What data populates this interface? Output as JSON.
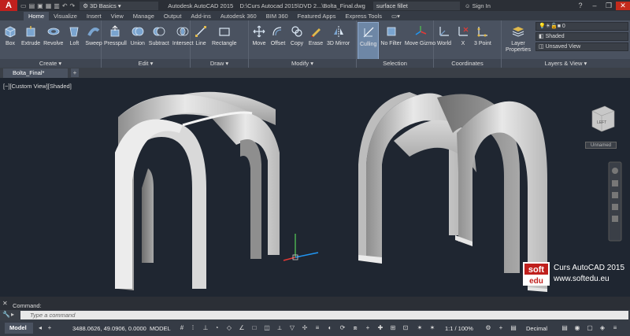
{
  "app": {
    "logo": "A",
    "workspace": "3D Basics",
    "product": "Autodesk AutoCAD 2015",
    "file_path": "D:\\Curs Autocad 2015\\DVD 2...\\Bolta_Final.dwg",
    "search_text": "surface fillet",
    "sign_in": "Sign In"
  },
  "tabs": [
    "Home",
    "Visualize",
    "Insert",
    "View",
    "Manage",
    "Output",
    "Add-ins",
    "Autodesk 360",
    "BIM 360",
    "Featured Apps",
    "Express Tools"
  ],
  "ribbon": {
    "create": {
      "title": "Create",
      "tools": [
        "Box",
        "Extrude",
        "Revolve",
        "Loft",
        "Sweep"
      ]
    },
    "edit": {
      "title": "Edit",
      "tools": [
        "Presspull",
        "Union",
        "Subtract",
        "Intersect"
      ]
    },
    "draw": {
      "title": "Draw",
      "tools": [
        "Line",
        "Rectangle"
      ]
    },
    "modify": {
      "title": "Modify",
      "tools": [
        "Move",
        "Offset",
        "Copy",
        "Erase",
        "3D Mirror"
      ]
    },
    "selection": {
      "title": "Selection",
      "tools": [
        "Culling",
        "No Filter",
        "Move Gizmo"
      ]
    },
    "coordinates": {
      "title": "Coordinates",
      "tools": [
        "World",
        "X",
        "3 Point"
      ]
    },
    "layers": {
      "title": "Layers & View",
      "tool": "Layer Properties",
      "layer_value": "0",
      "visual_style": "Shaded",
      "view": "Unsaved View"
    }
  },
  "document_tab": "Bolta_Final*",
  "viewport": {
    "label": "[−][Custom View][Shaded]",
    "viewcube_label": "Unnamed"
  },
  "command": {
    "history": "Command:",
    "placeholder": "Type a command"
  },
  "status": {
    "model_tab": "Model",
    "coords": "3488.0626, 49.0906, 0.0000",
    "mode": "MODEL",
    "scale": "1:1 / 100%",
    "units": "Decimal"
  },
  "watermark": {
    "logo": "soft edu",
    "line1": "Curs AutoCAD 2015",
    "line2": "www.softedu.eu"
  },
  "colors": {
    "ribbon": "#4a5260",
    "viewport": "#1f2631",
    "accent": "#c0201d"
  }
}
